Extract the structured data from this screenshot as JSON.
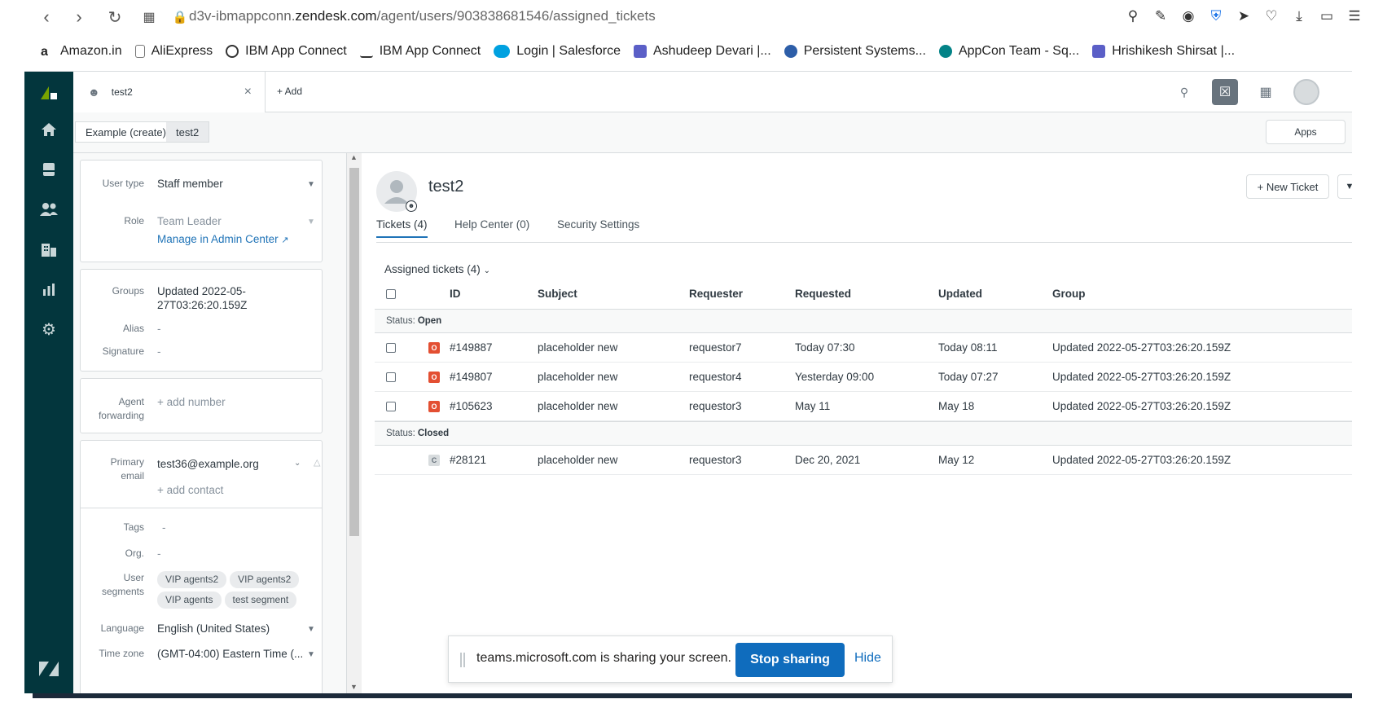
{
  "browser": {
    "url_prefix": "d3v-ibmappconn.",
    "url_domain": "zendesk.com",
    "url_path": "/agent/users/903838681546/assigned_tickets",
    "bookmarks": [
      "Amazon.in",
      "AliExpress",
      "IBM App Connect",
      "IBM App Connect",
      "Login | Salesforce",
      "Ashudeep Devari |...",
      "Persistent Systems...",
      "AppCon Team - Sq...",
      "Hrishikesh Shirsat |..."
    ]
  },
  "topbar": {
    "tab_label": "test2",
    "add_label": "+ Add"
  },
  "subbar": {
    "crumbs": [
      "Example (create)",
      "test2"
    ],
    "apps_label": "Apps"
  },
  "panel": {
    "user_type_label": "User type",
    "user_type_value": "Staff member",
    "role_label": "Role",
    "role_value": "Team Leader",
    "manage_link": "Manage in Admin Center",
    "groups_label": "Groups",
    "groups_value_line1": "Updated 2022-05-",
    "groups_value_line2": "27T03:26:20.159Z",
    "alias_label": "Alias",
    "alias_value": "-",
    "signature_label": "Signature",
    "signature_value": "-",
    "agent_fwd_label_1": "Agent",
    "agent_fwd_label_2": "forwarding",
    "add_number": "+ add number",
    "primary_email_label_1": "Primary",
    "primary_email_label_2": "email",
    "primary_email_value": "test36@example.org",
    "add_contact": "+ add contact",
    "tags_label": "Tags",
    "tags_value": "-",
    "org_label": "Org.",
    "org_value": "-",
    "segments_label_1": "User",
    "segments_label_2": "segments",
    "segments": [
      "VIP agents2",
      "VIP agents2",
      "VIP agents",
      "test segment"
    ],
    "language_label": "Language",
    "language_value": "English (United States)",
    "timezone_label": "Time zone",
    "timezone_value": "(GMT-04:00) Eastern Time (..."
  },
  "main": {
    "user_name": "test2",
    "new_ticket": "+ New Ticket",
    "tabs": [
      "Tickets (4)",
      "Help Center (0)",
      "Security Settings"
    ],
    "assigned_title": "Assigned tickets (4)",
    "columns": [
      "ID",
      "Subject",
      "Requester",
      "Requested",
      "Updated",
      "Group"
    ],
    "status_prefix": "Status:",
    "group_open": "Open",
    "group_closed": "Closed",
    "open_tickets": [
      {
        "badge": "O",
        "id": "#149887",
        "subject": "placeholder new",
        "requester": "requestor7",
        "requested": "Today 07:30",
        "updated": "Today 08:11",
        "group": "Updated 2022-05-27T03:26:20.159Z"
      },
      {
        "badge": "O",
        "id": "#149807",
        "subject": "placeholder new",
        "requester": "requestor4",
        "requested": "Yesterday 09:00",
        "updated": "Today 07:27",
        "group": "Updated 2022-05-27T03:26:20.159Z"
      },
      {
        "badge": "O",
        "id": "#105623",
        "subject": "placeholder new",
        "requester": "requestor3",
        "requested": "May 11",
        "updated": "May 18",
        "group": "Updated 2022-05-27T03:26:20.159Z"
      }
    ],
    "closed_tickets": [
      {
        "badge": "C",
        "id": "#28121",
        "subject": "placeholder new",
        "requester": "requestor3",
        "requested": "Dec 20, 2021",
        "updated": "May 12",
        "group": "Updated 2022-05-27T03:26:20.159Z"
      }
    ]
  },
  "sharebar": {
    "text": "teams.microsoft.com is sharing your screen.",
    "stop_label": "Stop sharing",
    "hide_label": "Hide"
  },
  "colors": {
    "rail": "#03363d",
    "open_badge": "#e34f32",
    "link": "#1f73b7",
    "teams_blue": "#0f6cbd"
  }
}
